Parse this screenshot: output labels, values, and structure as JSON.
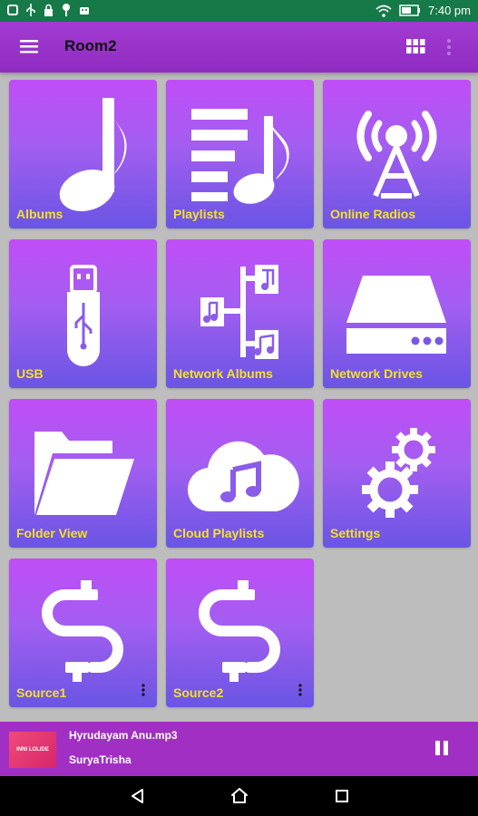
{
  "status_bar": {
    "time": "7:40 pm",
    "left_icons": [
      "notification-icon",
      "usb-icon",
      "lock-icon",
      "pin-icon",
      "android-icon"
    ],
    "right_icons": [
      "wifi-icon",
      "battery-icon"
    ]
  },
  "app_bar": {
    "title": "Room2",
    "menu_icon": "hamburger-menu-icon",
    "grid_icon": "grid-view-icon",
    "more_icon": "more-vert-icon"
  },
  "tiles": [
    {
      "label": "Albums",
      "icon": "music-note-icon"
    },
    {
      "label": "Playlists",
      "icon": "playlist-icon"
    },
    {
      "label": "Online Radios",
      "icon": "radio-tower-icon"
    },
    {
      "label": "USB",
      "icon": "usb-drive-icon"
    },
    {
      "label": "Network Albums",
      "icon": "network-music-icon"
    },
    {
      "label": "Network Drives",
      "icon": "hard-drive-icon"
    },
    {
      "label": "Folder View",
      "icon": "folder-icon"
    },
    {
      "label": "Cloud Playlists",
      "icon": "cloud-music-icon"
    },
    {
      "label": "Settings",
      "icon": "gears-icon"
    },
    {
      "label": "Source1",
      "icon": "cable-icon",
      "has_more": true
    },
    {
      "label": "Source2",
      "icon": "cable-icon",
      "has_more": true
    }
  ],
  "now_playing": {
    "title": "Hyrudayam Anu.mp3",
    "artist": "SuryaTrisha",
    "album_art_text": "INNI LOLIDE",
    "pause_icon": "pause-icon"
  },
  "nav_bar": {
    "icons": [
      "back-icon",
      "home-icon",
      "recents-icon"
    ]
  },
  "colors": {
    "status_bar": "#167a48",
    "app_bar": "#9b35cc",
    "tile_top": "#c04df7",
    "tile_bottom": "#6a55e4",
    "tile_label": "#f3e12a",
    "background": "#bdbdbd",
    "now_playing": "#a22fc4"
  }
}
